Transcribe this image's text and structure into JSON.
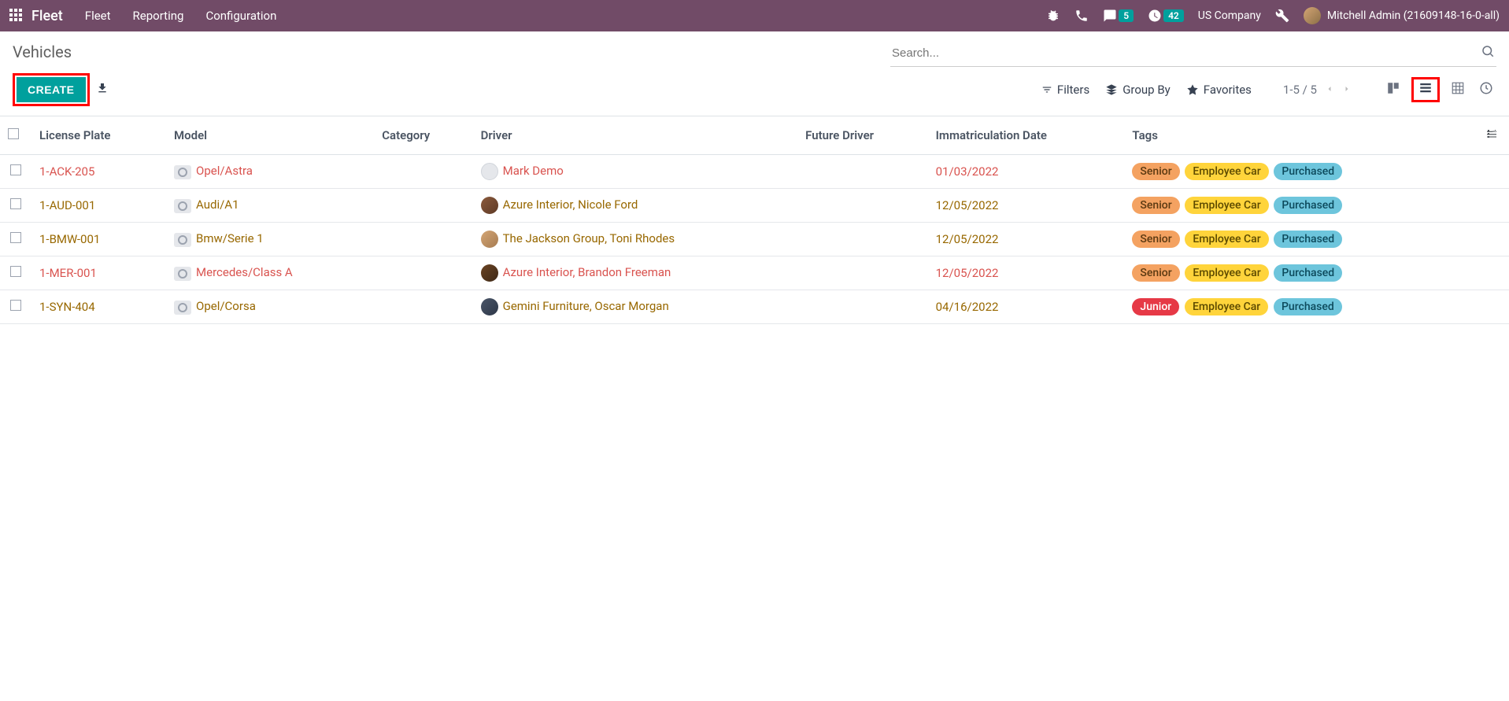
{
  "topnav": {
    "brand": "Fleet",
    "menu": [
      "Fleet",
      "Reporting",
      "Configuration"
    ],
    "chat_badge": "5",
    "clock_badge": "42",
    "company": "US Company",
    "user": "Mitchell Admin (21609148-16-0-all)"
  },
  "breadcrumb": "Vehicles",
  "search_placeholder": "Search...",
  "buttons": {
    "create": "CREATE",
    "filters": "Filters",
    "group_by": "Group By",
    "favorites": "Favorites"
  },
  "pager": "1-5 / 5",
  "columns": {
    "license_plate": "License Plate",
    "model": "Model",
    "category": "Category",
    "driver": "Driver",
    "future_driver": "Future Driver",
    "immatriculation": "Immatriculation Date",
    "tags": "Tags"
  },
  "tag_labels": {
    "senior": "Senior",
    "junior": "Junior",
    "employee_car": "Employee Car",
    "purchased": "Purchased"
  },
  "rows": [
    {
      "plate": "1-ACK-205",
      "model": "Opel/Astra",
      "driver": "Mark Demo",
      "date": "01/03/2022",
      "style": "red",
      "avatar": "ph",
      "senior": true
    },
    {
      "plate": "1-AUD-001",
      "model": "Audi/A1",
      "driver": "Azure Interior, Nicole Ford",
      "date": "12/05/2022",
      "style": "brown",
      "avatar": "c1",
      "senior": true
    },
    {
      "plate": "1-BMW-001",
      "model": "Bmw/Serie 1",
      "driver": "The Jackson Group, Toni Rhodes",
      "date": "12/05/2022",
      "style": "brown",
      "avatar": "c2",
      "senior": true
    },
    {
      "plate": "1-MER-001",
      "model": "Mercedes/Class A",
      "driver": "Azure Interior, Brandon Freeman",
      "date": "12/05/2022",
      "style": "red",
      "avatar": "c3",
      "senior": true
    },
    {
      "plate": "1-SYN-404",
      "model": "Opel/Corsa",
      "driver": "Gemini Furniture, Oscar Morgan",
      "date": "04/16/2022",
      "style": "brown",
      "avatar": "c4",
      "senior": false
    }
  ]
}
